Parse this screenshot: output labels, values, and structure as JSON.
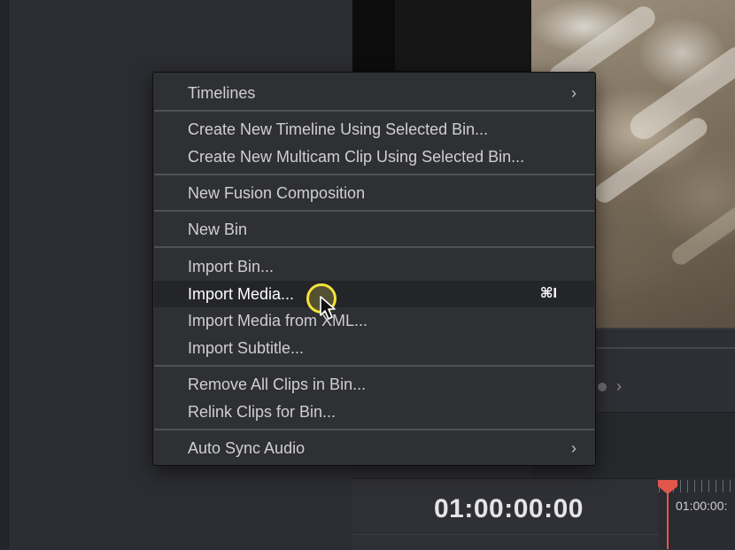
{
  "menu": {
    "items": [
      {
        "label": "Timelines",
        "submenu": true,
        "arrow": "›"
      },
      {
        "label": "Create New Timeline Using Selected Bin..."
      },
      {
        "label": "Create New Multicam Clip Using Selected Bin..."
      },
      {
        "label": "New Fusion Composition"
      },
      {
        "label": "New Bin"
      },
      {
        "label": "Import Bin..."
      },
      {
        "label": "Import Media...",
        "shortcut": "⌘I",
        "highlighted": true
      },
      {
        "label": "Import Media from XML..."
      },
      {
        "label": "Import Subtitle..."
      },
      {
        "label": "Remove All Clips in Bin..."
      },
      {
        "label": "Relink Clips for Bin..."
      },
      {
        "label": "Auto Sync Audio",
        "submenu": true,
        "arrow": "›"
      }
    ]
  },
  "timeline": {
    "timecode": "01:00:00:00",
    "ruler_label": "01:00:00:",
    "nav_arrow": "›"
  },
  "colors": {
    "menu_bg": "#2f3034",
    "highlight_bg": "#242529",
    "playhead": "#e2574c",
    "cursor_ring": "#f2e53a"
  },
  "icons": [
    "chevron-right-icon",
    "mouse-cursor-icon",
    "playhead-icon"
  ]
}
